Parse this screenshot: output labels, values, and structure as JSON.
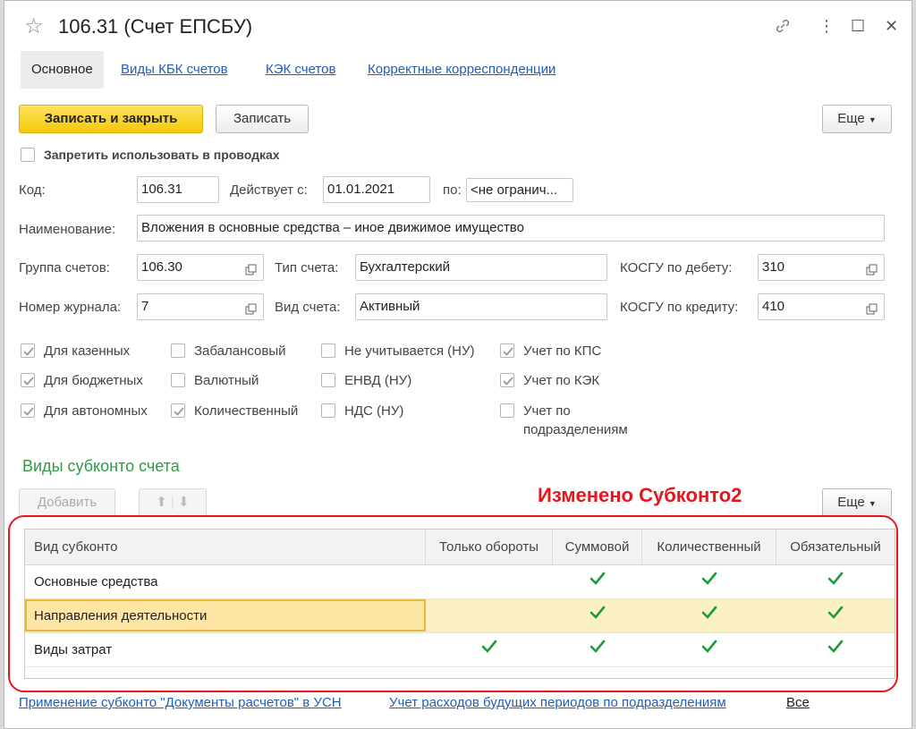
{
  "window": {
    "title": "106.31 (Счет ЕПСБУ)"
  },
  "tabs": [
    {
      "label": "Основное"
    },
    {
      "label": "Виды КБК счетов"
    },
    {
      "label": "КЭК счетов"
    },
    {
      "label": "Корректные корреспонденции"
    }
  ],
  "toolbar": {
    "save_close": "Записать и закрыть",
    "save": "Записать",
    "more": "Еще"
  },
  "forbid": {
    "label": "Запретить использовать в проводках",
    "checked": false
  },
  "fields": {
    "code_label": "Код:",
    "code_value": "106.31",
    "valid_from_label": "Действует с:",
    "valid_from_value": "01.01.2021",
    "valid_to_label": "по:",
    "valid_to_value": "<не огранич...",
    "name_label": "Наименование:",
    "name_value": "Вложения в основные средства – иное движимое имущество",
    "group_label": "Группа счетов:",
    "group_value": "106.30",
    "type_label": "Тип счета:",
    "type_value": "Бухгалтерский",
    "kosgu_debit_label": "КОСГУ по дебету:",
    "kosgu_debit_value": "310",
    "journal_label": "Номер журнала:",
    "journal_value": "7",
    "kind_label": "Вид счета:",
    "kind_value": "Активный",
    "kosgu_credit_label": "КОСГУ по кредиту:",
    "kosgu_credit_value": "410"
  },
  "checkboxes": [
    {
      "label": "Для казенных",
      "checked": true
    },
    {
      "label": "Для бюджетных",
      "checked": true
    },
    {
      "label": "Для автономных",
      "checked": true
    },
    {
      "label": "Забалансовый",
      "checked": false
    },
    {
      "label": "Валютный",
      "checked": false
    },
    {
      "label": "Количественный",
      "checked": true
    },
    {
      "label": "Не учитывается (НУ)",
      "checked": false
    },
    {
      "label": "ЕНВД (НУ)",
      "checked": false
    },
    {
      "label": "НДС (НУ)",
      "checked": false
    },
    {
      "label": "Учет по КПС",
      "checked": true
    },
    {
      "label": "Учет по КЭК",
      "checked": true
    },
    {
      "label": "Учет по",
      "label2": "подразделениям",
      "checked": false
    }
  ],
  "subconto": {
    "title": "Виды субконто счета",
    "add": "Добавить",
    "more": "Еще",
    "annotation": "Изменено Субконто2",
    "columns": [
      "Вид субконто",
      "Только обороты",
      "Суммовой",
      "Количественный",
      "Обязательный"
    ],
    "rows": [
      {
        "name": "Основные средства",
        "turnover": false,
        "sum": true,
        "qty": true,
        "required": true
      },
      {
        "name": "Направления деятельности",
        "turnover": false,
        "sum": true,
        "qty": true,
        "required": true
      },
      {
        "name": "Виды затрат",
        "turnover": true,
        "sum": true,
        "qty": true,
        "required": true
      }
    ],
    "check_color": "#1b9b3a"
  },
  "footer_links": [
    "Применение субконто \"Документы расчетов\" в УСН",
    "Учет расходов будущих периодов по подразделениям",
    "Все"
  ]
}
